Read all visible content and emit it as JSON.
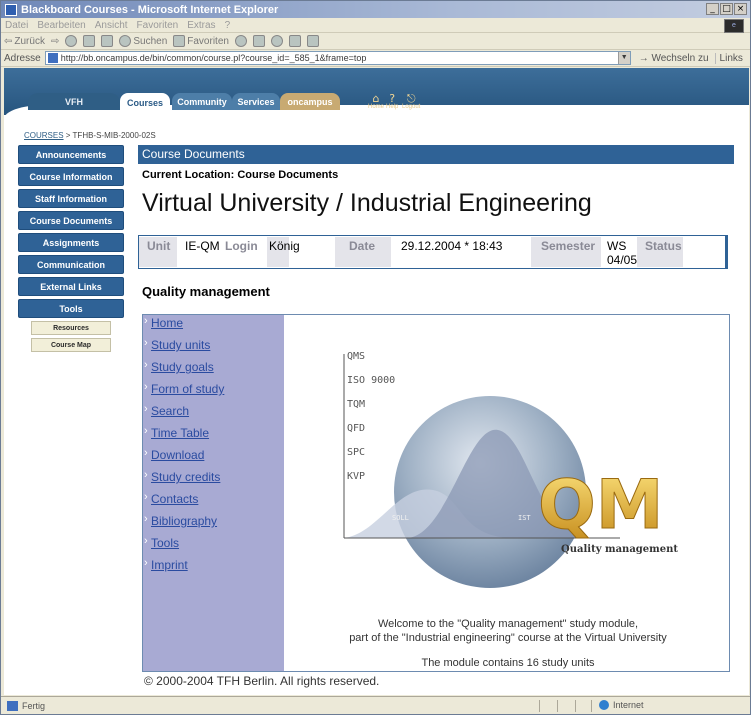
{
  "window": {
    "title": "Blackboard Courses - Microsoft Internet Explorer",
    "controls": [
      "_",
      "□",
      "×"
    ]
  },
  "menubar": [
    "Datei",
    "Bearbeiten",
    "Ansicht",
    "Favoriten",
    "Extras",
    "?"
  ],
  "toolbar": {
    "back": "Zurück",
    "search": "Suchen",
    "favorites": "Favoriten"
  },
  "addressbar": {
    "label": "Adresse",
    "url": "http://bb.oncampus.de/bin/common/course.pl?course_id=_585_1&frame=top",
    "go": "Wechseln zu",
    "links": "Links"
  },
  "bb_nav": {
    "tabs": [
      "VFH",
      "Courses",
      "Community",
      "Services",
      "oncampus"
    ],
    "utilities": [
      "Home",
      "Help",
      "Logout"
    ]
  },
  "breadcrumb": {
    "root": "COURSES",
    "separator": ">",
    "current": "TFHB-S-MIB-2000-02S"
  },
  "leftnav": {
    "items": [
      "Announcements",
      "Course Information",
      "Staff Information",
      "Course Documents",
      "Assignments",
      "Communication",
      "External Links",
      "Tools"
    ],
    "subitems": [
      "Resources",
      "Course Map"
    ]
  },
  "main": {
    "section_bar": "Course Documents",
    "location": "Current Location: Course Documents",
    "big_title": "Virtual University / Industrial Engineering",
    "info": {
      "unit_label": "Unit",
      "unit_value": "IE-QM",
      "login_label": "Login",
      "login_value": "König",
      "date_label": "Date",
      "date_value": "29.12.2004 * 18:43",
      "semester_label": "Semester",
      "semester_value_1": "WS",
      "semester_value_2": "04/05",
      "status_label": "Status"
    },
    "module_title": "Quality management",
    "module_links": [
      "Home",
      "Study units",
      "Study goals",
      "Form of study",
      "Search",
      "Time Table",
      "Download",
      "Study credits",
      "Contacts",
      "Bibliography",
      "Tools",
      "Imprint"
    ],
    "graphic": {
      "axis_labels": [
        "QMS",
        "ISO 9000",
        "TQM",
        "QFD",
        "SPC",
        "KVP"
      ],
      "curve_labels": [
        "SOLL",
        "IST"
      ],
      "logo_text": "QM",
      "caption": "Quality management"
    },
    "welcome_line1": "Welcome to the \"Quality management\" study module,",
    "welcome_line2": "part of the \"Industrial engineering\" course at the Virtual University",
    "units_line": "The module contains 16 study units",
    "copyright": "© 2000-2004 TFH Berlin. All rights reserved."
  },
  "statusbar": {
    "text": "Fertig",
    "zone": "Internet"
  }
}
